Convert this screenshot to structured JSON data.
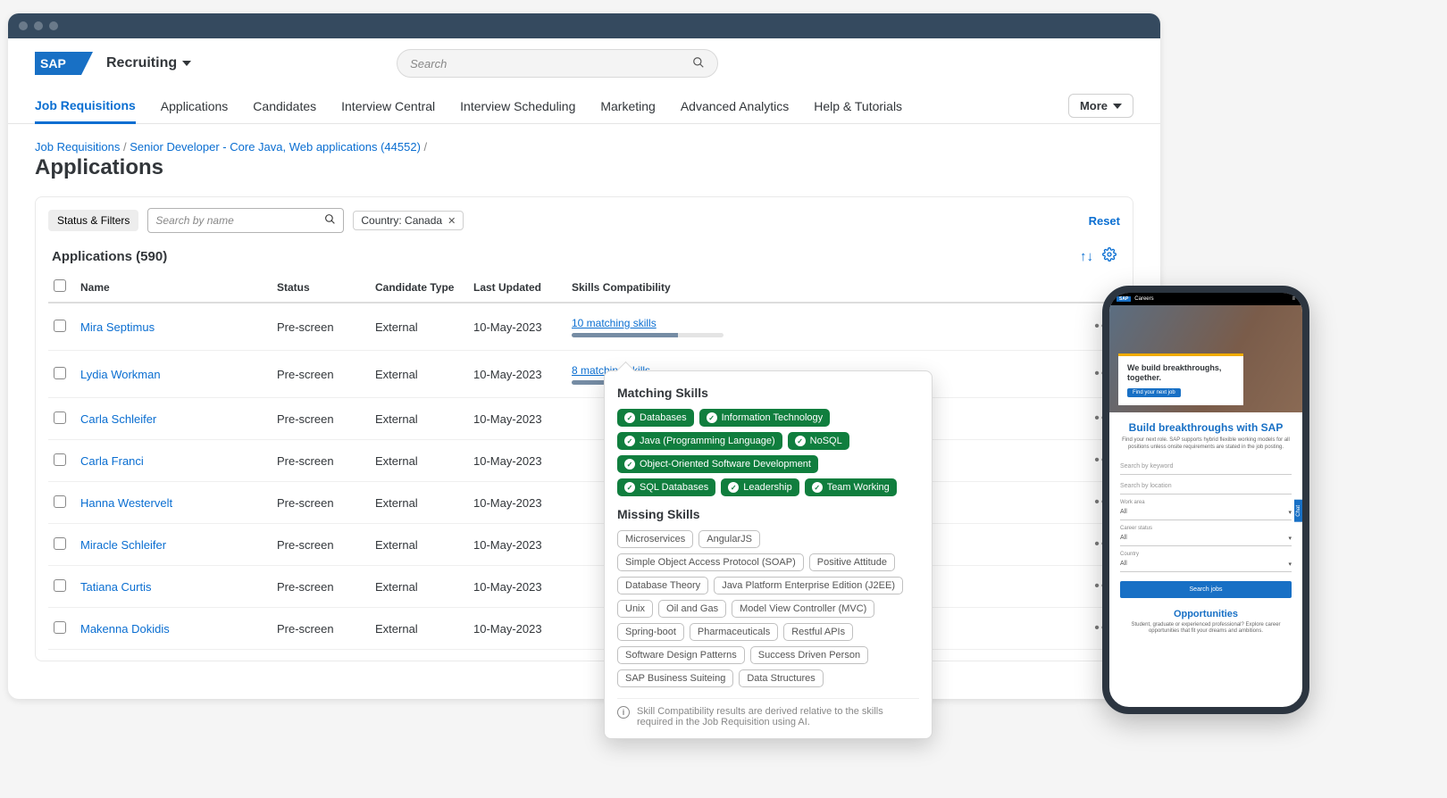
{
  "header": {
    "logo_text": "SAP",
    "app_name": "Recruiting",
    "search_placeholder": "Search",
    "more_label": "More"
  },
  "tabs": [
    "Job Requisitions",
    "Applications",
    "Candidates",
    "Interview Central",
    "Interview Scheduling",
    "Marketing",
    "Advanced Analytics",
    "Help & Tutorials"
  ],
  "active_tab_index": 0,
  "breadcrumb": {
    "root": "Job Requisitions",
    "item": "Senior Developer - Core Java, Web applications (44552)"
  },
  "page_title": "Applications",
  "filters": {
    "status_filters_label": "Status & Filters",
    "name_search_placeholder": "Search by name",
    "country_chip": "Country: Canada",
    "reset_label": "Reset"
  },
  "table": {
    "title": "Applications (590)",
    "columns": [
      "Name",
      "Status",
      "Candidate Type",
      "Last Updated",
      "Skills Compatibility"
    ],
    "rows": [
      {
        "name": "Mira Septimus",
        "status": "Pre-screen",
        "candidate_type": "External",
        "last_updated": "10-May-2023",
        "skills_text": "10 matching skills",
        "skills_pct": 70
      },
      {
        "name": "Lydia Workman",
        "status": "Pre-screen",
        "candidate_type": "External",
        "last_updated": "10-May-2023",
        "skills_text": "8 matching skills",
        "skills_pct": 70
      },
      {
        "name": "Carla Schleifer",
        "status": "Pre-screen",
        "candidate_type": "External",
        "last_updated": "10-May-2023",
        "skills_text": "",
        "skills_pct": 0
      },
      {
        "name": "Carla Franci",
        "status": "Pre-screen",
        "candidate_type": "External",
        "last_updated": "10-May-2023",
        "skills_text": "",
        "skills_pct": 0
      },
      {
        "name": "Hanna Westervelt",
        "status": "Pre-screen",
        "candidate_type": "External",
        "last_updated": "10-May-2023",
        "skills_text": "",
        "skills_pct": 0
      },
      {
        "name": "Miracle Schleifer",
        "status": "Pre-screen",
        "candidate_type": "External",
        "last_updated": "10-May-2023",
        "skills_text": "",
        "skills_pct": 0
      },
      {
        "name": "Tatiana Curtis",
        "status": "Pre-screen",
        "candidate_type": "External",
        "last_updated": "10-May-2023",
        "skills_text": "",
        "skills_pct": 0
      },
      {
        "name": "Makenna Dokidis",
        "status": "Pre-screen",
        "candidate_type": "External",
        "last_updated": "10-May-2023",
        "skills_text": "",
        "skills_pct": 0
      }
    ]
  },
  "popover": {
    "matching_title": "Matching Skills",
    "matching": [
      "Databases",
      "Information Technology",
      "Java (Programming Language)",
      "NoSQL",
      "Object-Oriented Software Development",
      "SQL Databases",
      "Leadership",
      "Team Working"
    ],
    "missing_title": "Missing Skills",
    "missing": [
      "Microservices",
      "AngularJS",
      "Simple Object Access Protocol (SOAP)",
      "Positive Attitude",
      "Database Theory",
      "Java Platform Enterprise Edition (J2EE)",
      "Unix",
      "Oil and Gas",
      "Model View Controller (MVC)",
      "Spring-boot",
      "Pharmaceuticals",
      "Restful APIs",
      "Software Design Patterns",
      "Success Driven Person",
      "SAP Business Suiteing",
      "Data Structures"
    ],
    "footer": "Skill Compatibility results are derived relative to the skills required in the Job Requisition using AI."
  },
  "phone": {
    "header_app": "Careers",
    "hero_title": "We build breakthroughs, together.",
    "hero_cta": "Find your next job",
    "body_title": "Build breakthroughs with SAP",
    "body_sub": "Find your next role. SAP supports hybrid flexible working models for all positions unless onsite requirements are stated in the job posting.",
    "keyword_placeholder": "Search by keyword",
    "location_placeholder": "Search by location",
    "work_area_label": "Work area",
    "work_area_value": "All",
    "career_status_label": "Career status",
    "career_status_value": "All",
    "country_label": "Country",
    "country_value": "All",
    "search_btn": "Search jobs",
    "opp_title": "Opportunities",
    "opp_sub": "Student, graduate or experienced professional? Explore career opportunities that fit your dreams and ambitions.",
    "side_tab": "Chat"
  }
}
